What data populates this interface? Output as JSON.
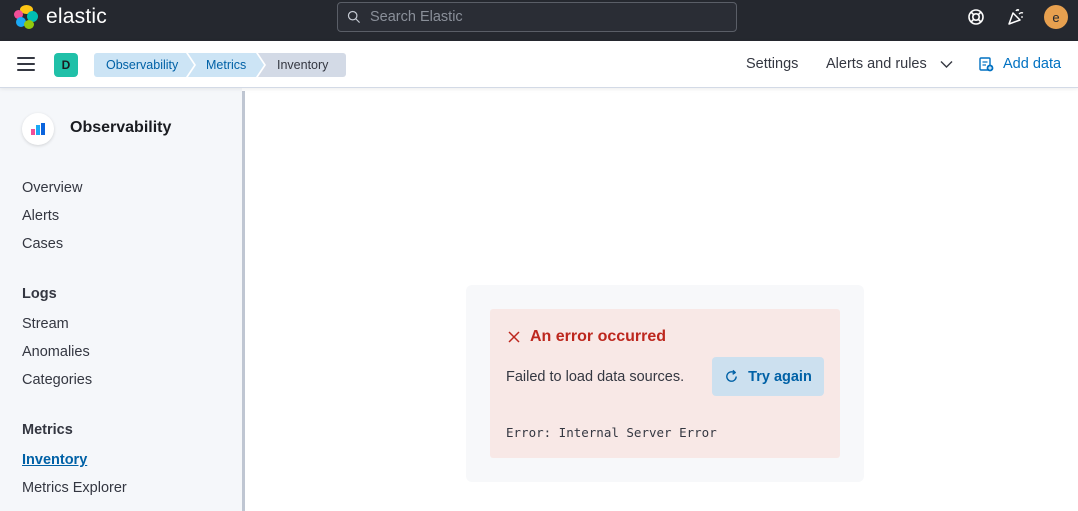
{
  "header": {
    "brand": "elastic",
    "search_placeholder": "Search Elastic",
    "icons": [
      "help-icon",
      "newsfeed-icon"
    ],
    "avatar_initial": "e",
    "avatar_color": "#e7a04f"
  },
  "subheader": {
    "space_initial": "D",
    "space_color": "#20c0a8",
    "breadcrumbs": [
      "Observability",
      "Metrics",
      "Inventory"
    ],
    "settings_label": "Settings",
    "alerts_label": "Alerts and rules",
    "add_data_label": "Add data"
  },
  "sidebar": {
    "title": "Observability",
    "top_items": [
      "Overview",
      "Alerts",
      "Cases"
    ],
    "logs": {
      "heading": "Logs",
      "items": [
        "Stream",
        "Anomalies",
        "Categories"
      ]
    },
    "metrics": {
      "heading": "Metrics",
      "items": [
        "Inventory",
        "Metrics Explorer"
      ],
      "active": "Inventory"
    }
  },
  "error": {
    "title": "An error occurred",
    "message": "Failed to load data sources.",
    "retry_label": "Try again",
    "code": "Error: Internal Server Error",
    "color": "#bd271e"
  },
  "colors": {
    "link": "#0071c2",
    "header_bg": "#25282f"
  }
}
